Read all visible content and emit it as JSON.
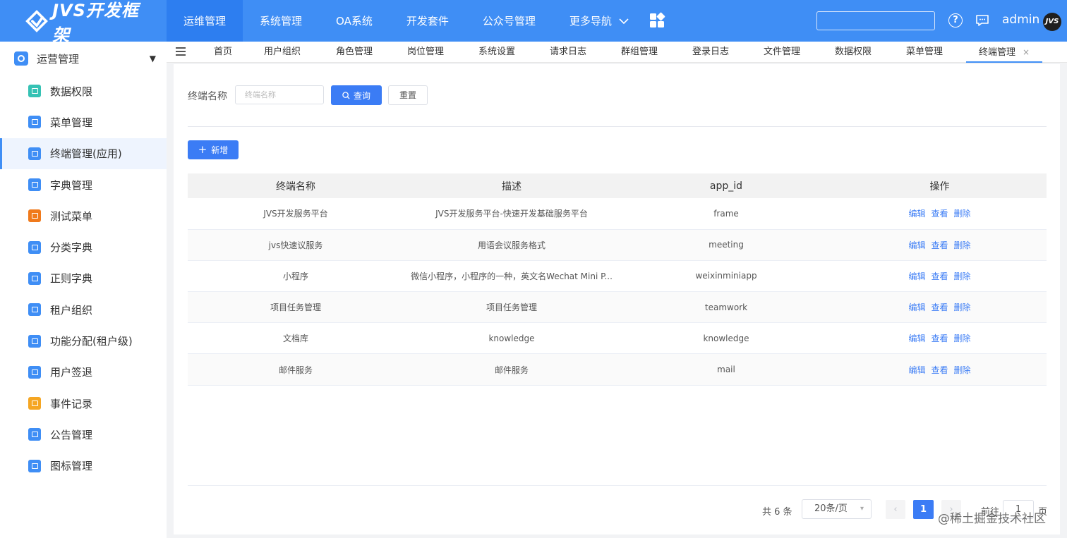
{
  "header": {
    "logo_text": "JVS开发框架",
    "nav": [
      {
        "label": "运维管理"
      },
      {
        "label": "系统管理"
      },
      {
        "label": "OA系统"
      },
      {
        "label": "开发套件"
      },
      {
        "label": "公众号管理"
      },
      {
        "label": "更多导航"
      }
    ],
    "user": "admin",
    "avatar_text": "JVS",
    "accent_color": "#3f8ef5"
  },
  "sidebar": {
    "group_label": "运营管理",
    "items": [
      {
        "label": "数据权限",
        "icon": "data-permission-icon",
        "color": "#36c2b4"
      },
      {
        "label": "菜单管理",
        "icon": "menu-icon",
        "color": "#3f8ef5"
      },
      {
        "label": "终端管理(应用)",
        "icon": "terminal-icon",
        "color": "#3f8ef5"
      },
      {
        "label": "字典管理",
        "icon": "dictionary-icon",
        "color": "#3f8ef5"
      },
      {
        "label": "测试菜单",
        "icon": "test-menu-icon",
        "color": "#f07a1c"
      },
      {
        "label": "分类字典",
        "icon": "category-dict-icon",
        "color": "#3f8ef5"
      },
      {
        "label": "正则字典",
        "icon": "regex-dict-icon",
        "color": "#3f8ef5"
      },
      {
        "label": "租户组织",
        "icon": "tenant-org-icon",
        "color": "#3f8ef5"
      },
      {
        "label": "功能分配(租户级)",
        "icon": "feature-assign-icon",
        "color": "#3f8ef5"
      },
      {
        "label": "用户签退",
        "icon": "user-signout-icon",
        "color": "#3f8ef5"
      },
      {
        "label": "事件记录",
        "icon": "event-log-icon",
        "color": "#f5a623"
      },
      {
        "label": "公告管理",
        "icon": "notice-icon",
        "color": "#3f8ef5"
      },
      {
        "label": "图标管理",
        "icon": "icon-manage-icon",
        "color": "#3f8ef5"
      }
    ]
  },
  "tabs": [
    {
      "label": "首页"
    },
    {
      "label": "用户组织"
    },
    {
      "label": "角色管理"
    },
    {
      "label": "岗位管理"
    },
    {
      "label": "系统设置"
    },
    {
      "label": "请求日志"
    },
    {
      "label": "群组管理"
    },
    {
      "label": "登录日志"
    },
    {
      "label": "文件管理"
    },
    {
      "label": "数据权限"
    },
    {
      "label": "菜单管理"
    },
    {
      "label": "终端管理"
    }
  ],
  "filter": {
    "label": "终端名称",
    "placeholder": "终端名称",
    "query_label": "查询",
    "reset_label": "重置"
  },
  "add_label": "新增",
  "table": {
    "columns": [
      "终端名称",
      "描述",
      "app_id",
      "操作"
    ],
    "rows": [
      {
        "name": "JVS开发服务平台",
        "desc": "JVS开发服务平台-快速开发基础服务平台",
        "app_id": "frame"
      },
      {
        "name": "jvs快速议服务",
        "desc": "用语会议服务格式",
        "app_id": "meeting"
      },
      {
        "name": "小程序",
        "desc": "微信小程序，小程序的一种，英文名Wechat Mini P...",
        "app_id": "weixinminiapp"
      },
      {
        "name": "项目任务管理",
        "desc": "项目任务管理",
        "app_id": "teamwork"
      },
      {
        "name": "文档库",
        "desc": "knowledge",
        "app_id": "knowledge"
      },
      {
        "name": "邮件服务",
        "desc": "邮件服务",
        "app_id": "mail"
      }
    ],
    "actions": {
      "edit": "编辑",
      "view": "查看",
      "delete": "删除"
    }
  },
  "pagination": {
    "total_text": "共 6 条",
    "page_size": "20条/页",
    "current_page": "1",
    "goto_label": "前往",
    "goto_value": "1",
    "goto_unit": "页"
  },
  "watermark": "@稀土掘金技术社区"
}
